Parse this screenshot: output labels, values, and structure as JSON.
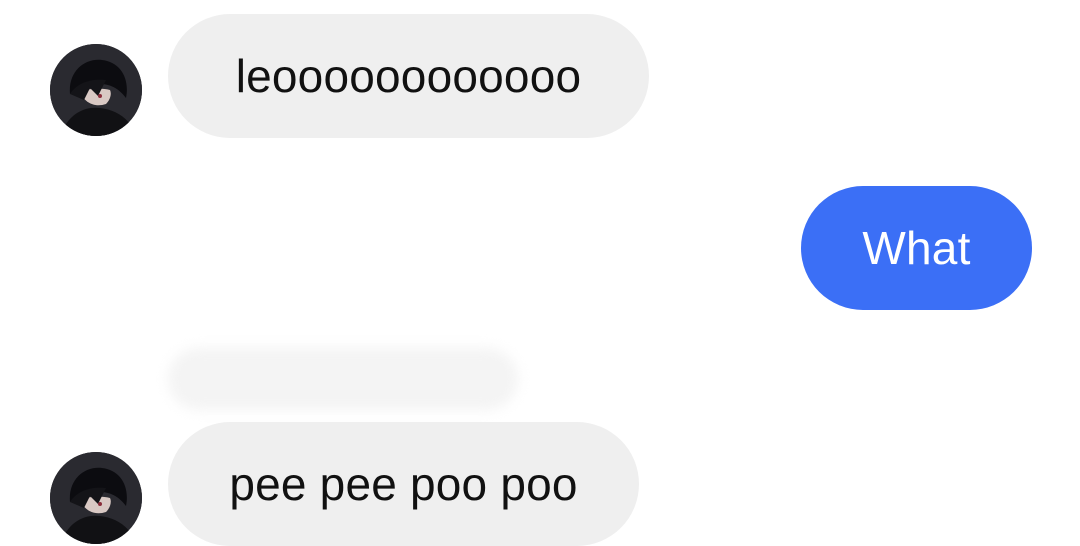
{
  "conversation": {
    "messages": [
      {
        "sender": "other",
        "text": "leoooooooooooo"
      },
      {
        "sender": "self",
        "text": "What"
      },
      {
        "sender": "other",
        "text": "pee pee poo poo"
      }
    ]
  },
  "colors": {
    "incoming_bubble": "#efefef",
    "outgoing_bubble": "#3b6ff6",
    "incoming_text": "#111111",
    "outgoing_text": "#ffffff"
  },
  "icons": {
    "avatar": "contact-avatar"
  }
}
